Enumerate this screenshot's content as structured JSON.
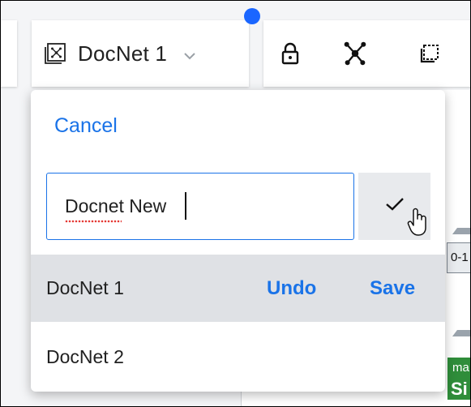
{
  "toolbar": {
    "document_title": "DocNet 1",
    "tools": [
      {
        "name": "lock",
        "icon": "lock-icon"
      },
      {
        "name": "network",
        "icon": "network-icon"
      },
      {
        "name": "select",
        "icon": "selection-icon"
      }
    ]
  },
  "dropdown": {
    "cancel_label": "Cancel",
    "name_input": {
      "value": "Docnet New",
      "placeholder": ""
    },
    "confirm_icon": "checkmark-icon",
    "items": [
      {
        "label": "DocNet 1",
        "selected": true,
        "undo_label": "Undo",
        "save_label": "Save"
      },
      {
        "label": "DocNet 2",
        "selected": false
      }
    ]
  },
  "canvas_fragments": {
    "node_label_1": "0-1",
    "node_label_2": "ma",
    "node_label_3": "Si"
  },
  "colors": {
    "accent": "#1a73e8",
    "indicator": "#1a66ff",
    "selected_row": "#dfe1e5",
    "node_green": "#2f8d3a"
  }
}
